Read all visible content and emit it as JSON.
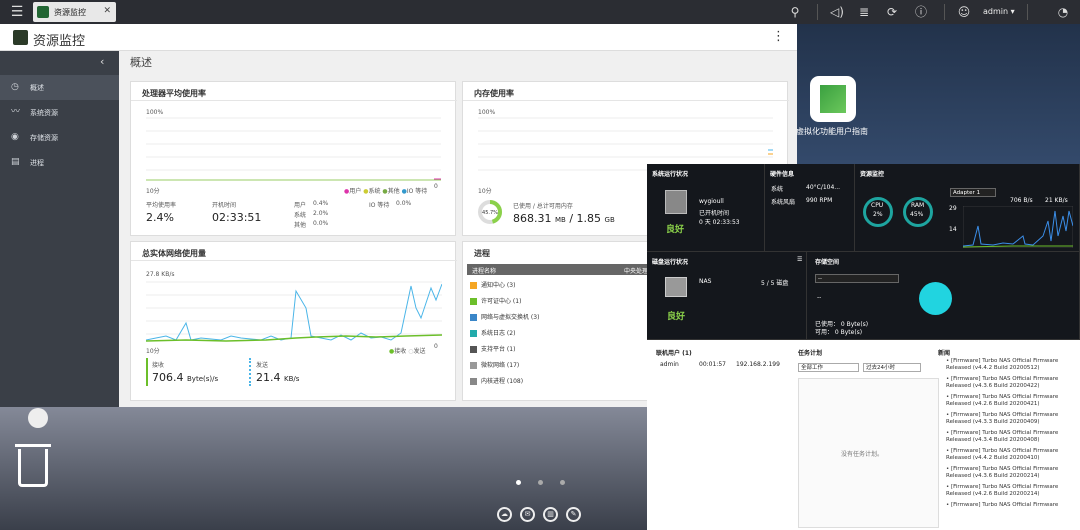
{
  "topbar": {
    "app_tab": "资源监控",
    "user": "admin ▾"
  },
  "window": {
    "title": "资源监控"
  },
  "sidebar": {
    "items": [
      {
        "label": "概述"
      },
      {
        "label": "系统资源"
      },
      {
        "label": "存储资源"
      },
      {
        "label": "进程"
      }
    ]
  },
  "overview": {
    "title": "概述",
    "cpu": {
      "title": "处理器平均使用率",
      "y_top": "100%",
      "x_left": "10分",
      "legend": [
        "用户",
        "系统",
        "其他",
        "IO 等待"
      ],
      "zero": "0",
      "avg_label": "平均使用率",
      "avg_value": "2.4%",
      "uptime_label": "开机时间",
      "uptime_value": "02:33:51",
      "user_label": "用户",
      "user_value": "0.4%",
      "system_label": "系统",
      "system_value": "2.0%",
      "other_label": "其他",
      "other_value": "0.0%",
      "io_label": "IO 等待",
      "io_value": "0.0%"
    },
    "memory": {
      "title": "内存使用率",
      "y_top": "100%",
      "x_left": "10分",
      "zero": "0",
      "pct": "45.7%",
      "caption": "已使用 / 总计可用内存",
      "used": "868.31",
      "used_unit": "MB",
      "total": "1.85",
      "total_unit": "GB"
    },
    "network": {
      "title": "总实体网络使用量",
      "y_top": "27.8 KB/s",
      "x_left": "10分",
      "zero": "0",
      "legend": [
        "接收",
        "发送"
      ],
      "rx_label": "接收",
      "rx_value": "706.4",
      "rx_unit": "Byte(s)/s",
      "tx_label": "发送",
      "tx_value": "21.4",
      "tx_unit": "KB/s"
    },
    "process": {
      "title": "进程",
      "col_name": "进程名称",
      "col_cpu": "中央处理",
      "rows": [
        "通知中心 (3)",
        "许可证中心 (1)",
        "网络与虚拟交换机 (3)",
        "系统日志 (2)",
        "支持平台 (1)",
        "微软网络 (17)",
        "内核进程 (108)"
      ]
    }
  },
  "desktop": {
    "app_label": "虚拟化功能用户指南"
  },
  "dashboard": {
    "sys": {
      "title": "系统运行状况",
      "host": "wygioull",
      "uptime_label": "已开机时间",
      "uptime": "0 天 02:33:53",
      "status": "良好"
    },
    "hw": {
      "title": "硬件信息",
      "sys_label": "系统",
      "sys_value": "40°C/104...",
      "fan_label": "系统风扇",
      "fan_value": "990 RPM"
    },
    "res": {
      "title": "资源监控",
      "adapter": "Adapter 1",
      "rx": "706 B/s",
      "tx": "21 KB/s",
      "cpu_label": "CPU",
      "cpu_value": "2%",
      "ram_label": "RAM",
      "ram_value": "45%",
      "y_max": "29",
      "y_mid": "14"
    },
    "disk": {
      "title": "磁盘运行状况",
      "nas": "NAS",
      "count": "5 / 5 磁盘",
      "status": "良好"
    },
    "storage": {
      "title": "存储空间",
      "select": "--",
      "dash": "--",
      "used": "已使用： 0 Byte(s)",
      "free": "可用： 0 Byte(s)"
    },
    "online": {
      "title": "联机用户 (1)",
      "user": "admin",
      "time": "00:01:57",
      "ip": "192.168.2.199"
    },
    "tasks": {
      "title": "任务计划",
      "filter1": "全部工作",
      "filter2": "过去24小时",
      "empty": "没有任务计划。"
    },
    "news": {
      "title": "新闻",
      "items": [
        "[Firmware] Turbo NAS Official Firmware Released (v4.4.2 Build 20200512)",
        "[Firmware] Turbo NAS Official Firmware Released (v4.3.6 Build 20200422)",
        "[Firmware] Turbo NAS Official Firmware Released (v4.2.6 Build 20200421)",
        "[Firmware] Turbo NAS Official Firmware Released (v4.3.3 Build 20200409)",
        "[Firmware] Turbo NAS Official Firmware Released (v4.3.4 Build 20200408)",
        "[Firmware] Turbo NAS Official Firmware Released (v4.4.2 Build 20200410)",
        "[Firmware] Turbo NAS Official Firmware Released (v4.3.6 Build 20200214)",
        "[Firmware] Turbo NAS Official Firmware Released (v4.2.6 Build 20200214)",
        "[Firmware] Turbo NAS Official Firmware"
      ]
    }
  },
  "colors": {
    "accent": "#8bd14a",
    "teal": "#1ea5a0",
    "net_rx": "#6cbf2a",
    "net_tx": "#4ab5e8",
    "dark": "#14171c"
  }
}
